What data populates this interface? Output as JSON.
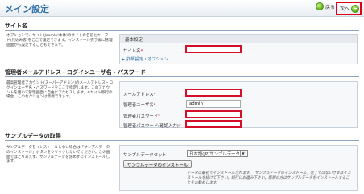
{
  "header": {
    "title": "メイン設定",
    "back_label": "戻る",
    "next_label": "次へ"
  },
  "site_section": {
    "title": "サイト名",
    "description": "オプションで、サイト(Joomla!本体)のサイトの名前とキーワード(見込み客)をここで設定できます。インストール完了後に管理画面から設定することもできます。",
    "box_title": "基本設定",
    "site_name_label": "サイト名",
    "site_name_value": "",
    "advanced_link": "詳細設定・オプション"
  },
  "admin_section": {
    "title": "管理者メールアドレス・ログインユーザ名・パスワード",
    "description": "最高管理者アカウント(スーパーアドミン)のメールアドレス・ログインユーザ名・パスワードをここで指定します。このアカウントを用いて管理画面に自由にアクセスします。※サイト移行の場合、このセクションは無視できます。",
    "email_label": "メールアドレス",
    "email_value": "",
    "username_label": "管理者ユーザ名",
    "username_value": "admin",
    "password_label": "管理者パスワード",
    "password_value": "",
    "password_confirm_label": "管理者パスワード(確認入力)",
    "password_confirm_value": ""
  },
  "sample_section": {
    "title": "サンプルデータの取得",
    "description": "サンプルデータをインストールしない場合は「サンプルデータのインストール」ボタンをクリックしないでください。この画面ではとりあえず、サンプルデータを含めずにインストールします。",
    "set_label": "サンプルデータセット",
    "selected_set": "日本語(JP)サンプルデータ",
    "install_button": "サンプルデータのインストール",
    "note": "データは最初でインストールされます。「サンプルデータのインストール」完了ではないさまはインストールを続けて下さい。続行にお進み下さい。新規の方はサンプルデータをインストールすることをお勧めします。"
  },
  "required_marker": "*"
}
